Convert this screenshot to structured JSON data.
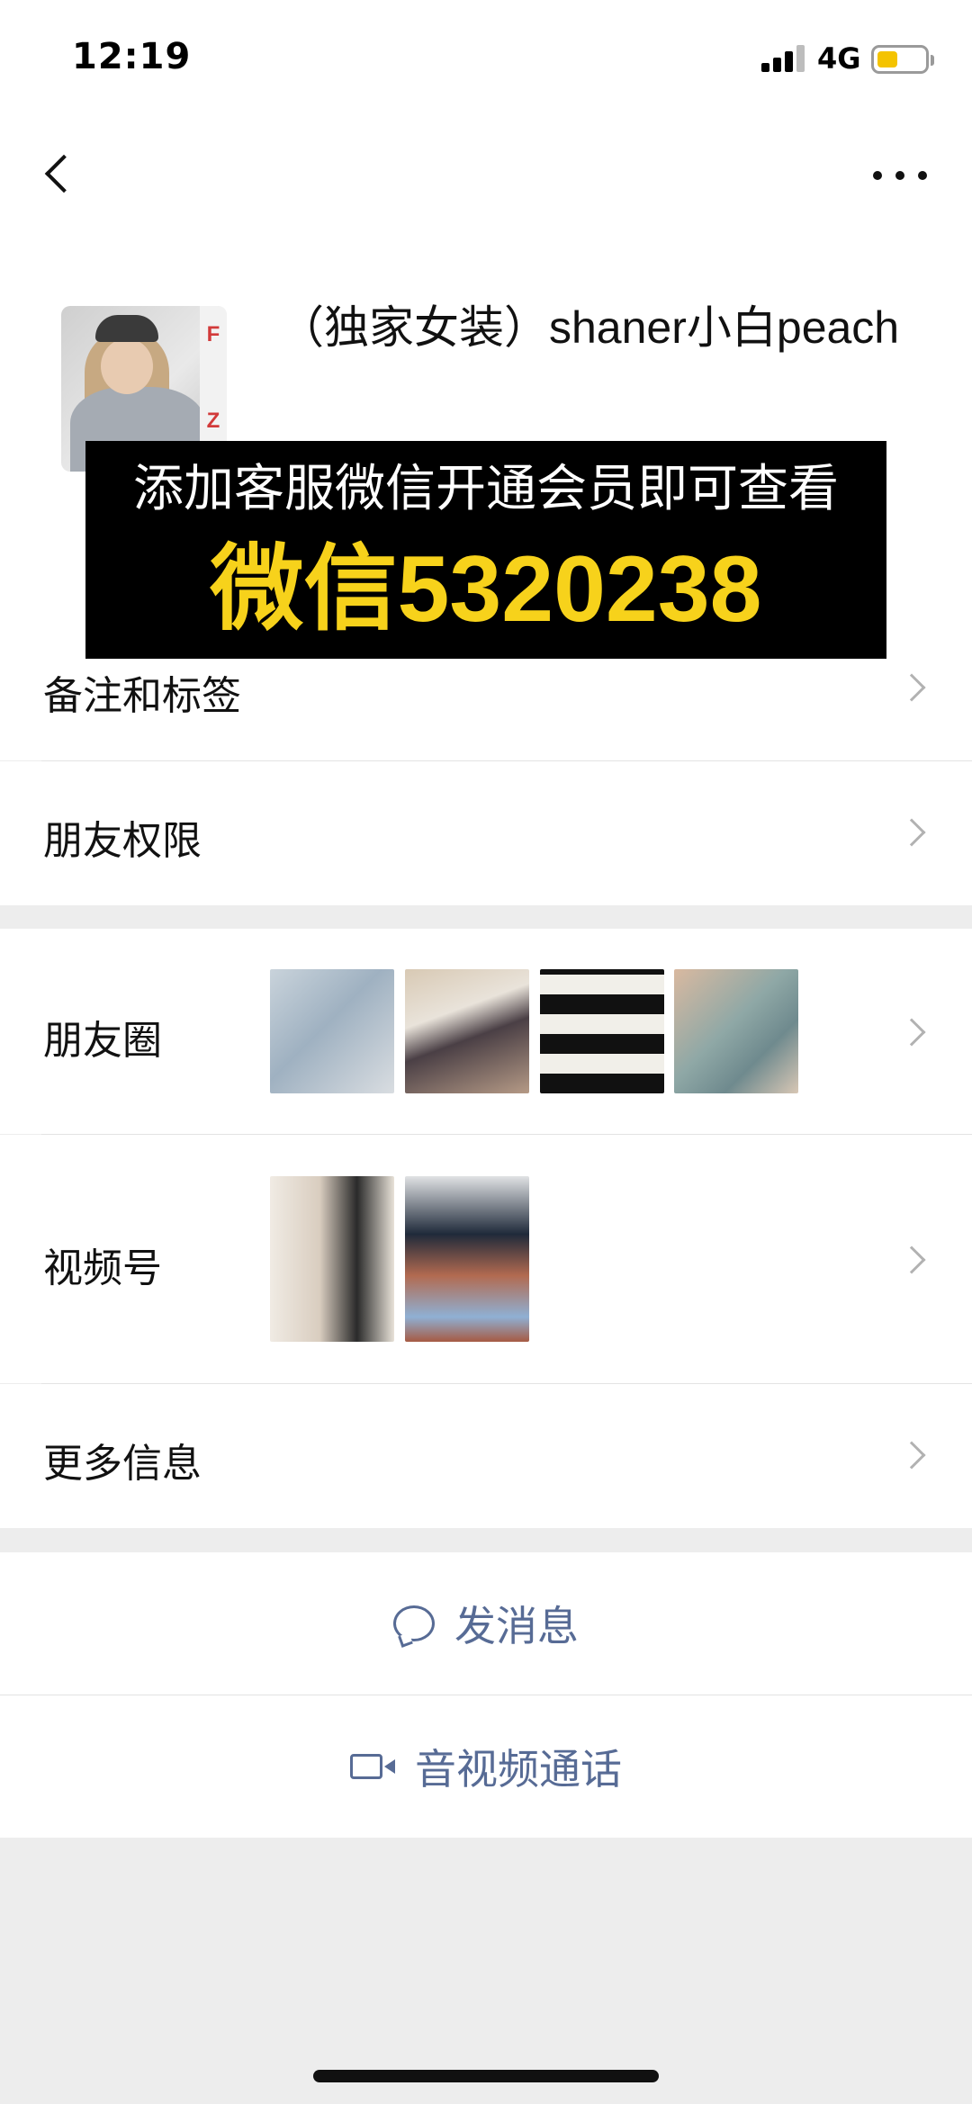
{
  "status_bar": {
    "time": "12:19",
    "network": "4G",
    "battery_color": "#f4c300"
  },
  "profile": {
    "name": "（独家女装）shaner小白peach",
    "avatar_text": [
      "F",
      "Z"
    ]
  },
  "overlay": {
    "line1": "添加客服微信开通会员即可查看",
    "line2": "微信5320238"
  },
  "rows": {
    "notes_tags": "备注和标签",
    "friend_permissions": "朋友权限",
    "moments": "朋友圈",
    "channels": "视频号",
    "more_info": "更多信息"
  },
  "actions": {
    "send_message": "发消息",
    "av_call": "音视频通话"
  },
  "colors": {
    "link": "#576b95",
    "overlay_highlight": "#f7d21b",
    "background": "#ededed"
  }
}
